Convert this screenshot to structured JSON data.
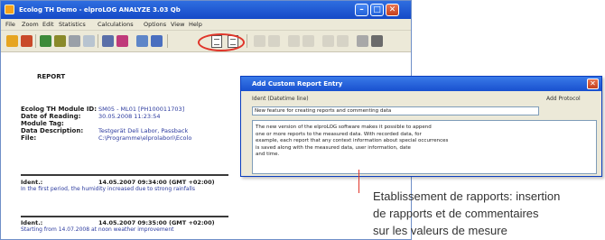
{
  "window": {
    "title": "Ecolog TH Demo - elproLOG ANALYZE 3.03 Qb",
    "min_glyph": "–",
    "max_glyph": "□",
    "close_glyph": "✕"
  },
  "menu": [
    "File",
    "Zoom",
    "Edit",
    "Statistics",
    "Calculations",
    "Options",
    "View",
    "Help"
  ],
  "toolbar_icons": [
    "alarm-icon",
    "chart-icon",
    "sensor-icon",
    "graph-icon",
    "print-icon",
    "export-icon",
    "report-icon",
    "report-icon-2",
    "doc-icon",
    "doc-icon-2",
    "zoom-icon",
    "cursor-icon",
    "settings-icon",
    "filter-icon"
  ],
  "report": {
    "title": "REPORT",
    "fields": [
      {
        "label": "Ecolog TH Module ID:",
        "value": "SM05 - ML01 [PH100011703]"
      },
      {
        "label": "Date of Reading:",
        "value": "30.05.2008  11:23:54"
      },
      {
        "label": "Module Tag:",
        "value": ""
      },
      {
        "label": "Data Description:",
        "value": "Testgerät Deli Labor, Passback"
      },
      {
        "label": "File:",
        "value": "C:\\Programme\\elprolabori\\Ecolo"
      }
    ],
    "entries": [
      {
        "label": "Ident.:",
        "date": "14.05.2007  09:34:00  (GMT +02:00)",
        "text": "In the first period, the humidity increased due to strong rainfalls"
      },
      {
        "label": "Ident.:",
        "date": "14.05.2007  09:35:00  (GMT +02:00)",
        "text": "Starting from 14.07.2008 at noon weather improvement"
      }
    ]
  },
  "dialog": {
    "title": "Add Custom Report Entry",
    "col_left": "Ident (Datetime line)",
    "col_right": "Add Protocol",
    "input_value": "New feature for creating reports and commenting data",
    "body_lines": [
      "The new version of the elproLOG software makes it possible to append",
      "one or more reports to the measured data. With recorded data, for",
      "example, each report that any context information about special occurrences",
      "is saved along with the measured data, user information, date",
      "and time."
    ],
    "close_glyph": "✕"
  },
  "callout": {
    "lines": [
      "Etablissement de rapports: insertion",
      "de rapports et de commentaires",
      "sur les valeurs de mesure"
    ]
  },
  "colors": {
    "titlebar": "#1549c7",
    "highlight": "#e0352a",
    "link_text": "#2b3a9e"
  }
}
